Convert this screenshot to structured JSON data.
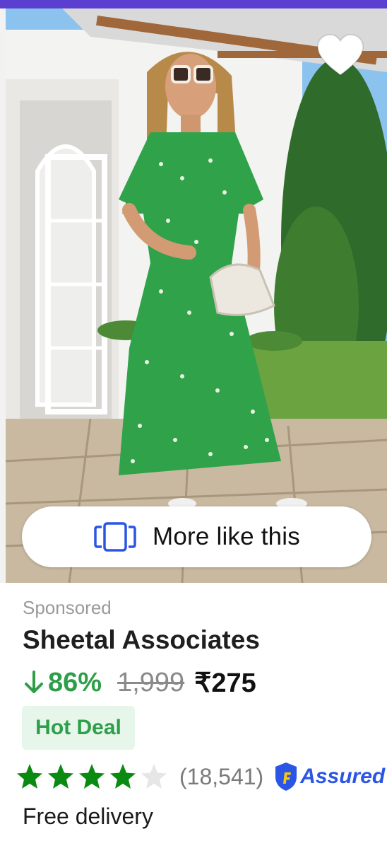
{
  "card": {
    "image_alt": "Woman in green floral print dress",
    "wishlist_icon": "heart-icon",
    "more_like_this": "More like this",
    "more_like_this_icon": "similar-cards-icon"
  },
  "product": {
    "sponsored_label": "Sponsored",
    "brand": "Sheetal Associates",
    "discount": "86%",
    "mrp": "1,999",
    "price": "₹275",
    "deal_label": "Hot Deal",
    "rating": 4,
    "rating_max": 5,
    "rating_count": "(18,541)",
    "assured_label": "Assured",
    "delivery": "Free delivery"
  },
  "colors": {
    "accent_top": "#5b3fd1",
    "discount_green": "#2e9e4a",
    "star_green": "#0b8a11",
    "assured_blue": "#2a55e5"
  }
}
